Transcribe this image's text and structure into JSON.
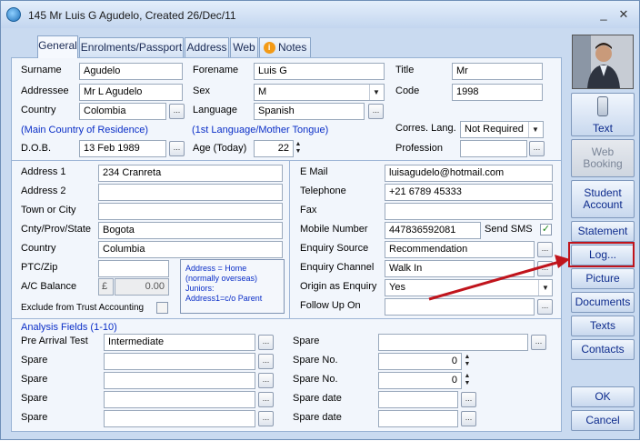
{
  "window": {
    "title": "145 Mr Luis G Agudelo,  Created 26/Dec/11",
    "min": "_",
    "close": "✕"
  },
  "tabs": [
    "General",
    "Enrolments/Passport",
    "Address",
    "Web",
    "Notes"
  ],
  "personal": {
    "surname_label": "Surname",
    "surname": "Agudelo",
    "forename_label": "Forename",
    "forename": "Luis G",
    "title_label": "Title",
    "title_value": "Mr",
    "addressee_label": "Addressee",
    "addressee": "Mr L Agudelo",
    "sex_label": "Sex",
    "sex": "M",
    "code_label": "Code",
    "code": "1998",
    "country_label": "Country",
    "country": "Colombia",
    "language_label": "Language",
    "language": "Spanish",
    "main_country_note": "(Main Country of Residence)",
    "language_note": "(1st Language/Mother Tongue)",
    "corres_lang_label": "Corres. Lang.",
    "corres_lang": "Not Required",
    "dob_label": "D.O.B.",
    "dob": "13 Feb 1989",
    "age_label": "Age (Today)",
    "age": "22",
    "profession_label": "Profession",
    "profession": ""
  },
  "address": {
    "address1_label": "Address 1",
    "address1": "234 Cranreta",
    "address2_label": "Address 2",
    "address2": "",
    "town_label": "Town or City",
    "town": "",
    "county_label": "Cnty/Prov/State",
    "county": "Bogota",
    "country_label": "Country",
    "country": "Columbia",
    "ptc_label": "PTC/Zip",
    "ptc": "",
    "ac_balance_label": "A/C Balance",
    "currency": "£",
    "ac_balance": "0.00",
    "exclude_label": "Exclude from Trust Accounting",
    "note_line1": "Address = Home",
    "note_line2": "(normally overseas)",
    "note_line3": "Juniors:",
    "note_line4": "Address1=c/o Parent"
  },
  "contact": {
    "email_label": "E Mail",
    "email": "luisagudelo@hotmail.com",
    "telephone_label": "Telephone",
    "telephone": "+21 6789 45333",
    "fax_label": "Fax",
    "fax": "",
    "mobile_label": "Mobile Number",
    "mobile": "447836592081",
    "send_sms_label": "Send SMS",
    "send_sms_check": "✓",
    "enquiry_source_label": "Enquiry Source",
    "enquiry_source": "Recommendation",
    "enquiry_channel_label": "Enquiry Channel",
    "enquiry_channel": "Walk In",
    "origin_label": "Origin as Enquiry",
    "origin": "Yes",
    "follow_up_label": "Follow Up On",
    "follow_up": ""
  },
  "analysis": {
    "heading": "Analysis Fields (1-10)",
    "pre_arrival_label": "Pre Arrival Test",
    "pre_arrival": "Intermediate",
    "spare_label": "Spare",
    "spare_no_label": "Spare No.",
    "spare_date_label": "Spare date",
    "spare_no_1": "0",
    "spare_no_2": "0"
  },
  "sidebar": {
    "text": "Text",
    "web_booking_1": "Web",
    "web_booking_2": "Booking",
    "student_account_1": "Student",
    "student_account_2": "Account",
    "statement": "Statement",
    "log": "Log...",
    "picture": "Picture",
    "documents": "Documents",
    "texts": "Texts",
    "contacts": "Contacts",
    "ok": "OK",
    "cancel": "Cancel"
  },
  "colors": {
    "annotation": "#c0141c",
    "accent": "#0a2ec7"
  },
  "icons": {
    "ellipsis": "...",
    "dropdown": "▼",
    "spin_up": "▲",
    "spin_down": "▼"
  }
}
